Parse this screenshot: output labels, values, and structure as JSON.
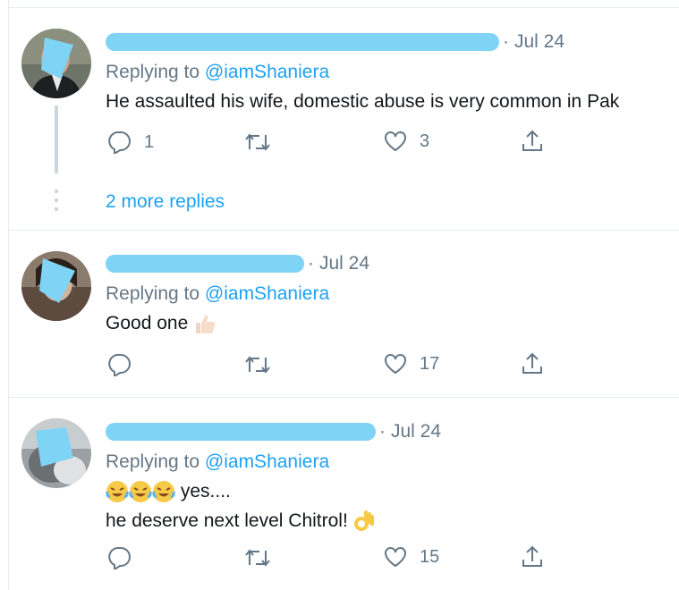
{
  "tweets": [
    {
      "date": "Jul 24",
      "replying_prefix": "Replying to ",
      "replying_handle": "@iamShaniera",
      "text": "He assaulted his wife, domestic abuse is very common in Pak",
      "reply_count": "1",
      "retweet_count": "",
      "like_count": "3"
    },
    {
      "date": "Jul 24",
      "replying_prefix": "Replying to ",
      "replying_handle": "@iamShaniera",
      "text": "Good one",
      "reply_count": "",
      "retweet_count": "",
      "like_count": "17"
    },
    {
      "date": "Jul 24",
      "replying_prefix": "Replying to ",
      "replying_handle": "@iamShaniera",
      "text_line1": "yes....",
      "text_line2": "he deserve next level Chitrol!",
      "reply_count": "",
      "retweet_count": "",
      "like_count": "15"
    }
  ],
  "more_replies": "2 more replies",
  "colors": {
    "link": "#1da1f2",
    "muted": "#657786",
    "redaction": "#7fd3f5"
  },
  "icons": [
    "reply-icon",
    "retweet-icon",
    "like-icon",
    "share-icon",
    "thumbs-up-emoji",
    "laughing-emoji",
    "ok-hand-emoji"
  ]
}
